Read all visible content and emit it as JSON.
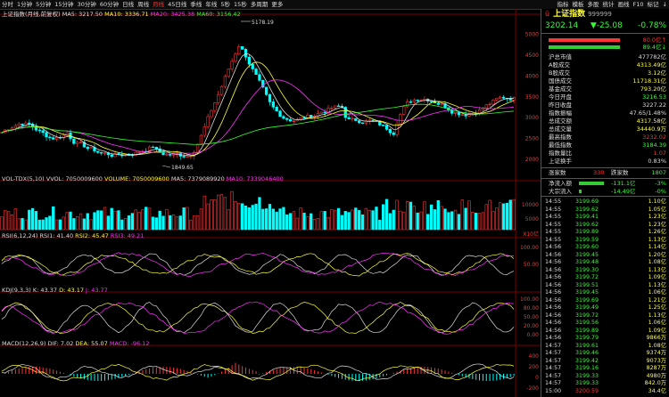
{
  "toolbar": {
    "periods": [
      "分时",
      "1分钟",
      "5分钟",
      "15分钟",
      "30分钟",
      "60分钟",
      "日线",
      "周线",
      "月线",
      "45日线",
      "季线",
      "年线",
      "5秒",
      "15秒",
      "多周期",
      "更多"
    ],
    "active_period": "月线",
    "right_items": [
      "指标",
      "模板",
      "多股",
      "统计",
      "画线",
      "F10",
      "标记",
      "↓"
    ]
  },
  "main_head": {
    "title": "上证指数(月线,前复权)",
    "ma5": "MA5: 3217.50",
    "ma10": "MA10: 3336.71",
    "ma20": "MA20: 3425.38",
    "ma60": "MA60: 3156.42"
  },
  "main_axis": {
    "labels": [
      "5000",
      "4500",
      "4000",
      "3500",
      "3000",
      "2500",
      "2000"
    ]
  },
  "main_annotations": {
    "high": "5178.19",
    "low": "1849.65"
  },
  "vol_head": {
    "title": "VOL-TDX(5,10)",
    "vvol": "VVOL: 7050009600",
    "volume": "VOLUME: 7050009600",
    "ma5": "MA5: 7379089920",
    "ma10": "MA10: 7339046400"
  },
  "vol_axis": {
    "labels": [
      "10000",
      "5000"
    ],
    "unit": "X10亿"
  },
  "rsi_head": {
    "title": "RSI(6,12,24)",
    "rsi1": "RSI1: 41.40",
    "rsi2": "RSI2: 45.47",
    "rsi3": "RSI3: 49.21"
  },
  "rsi_axis": {
    "labels": [
      "100.00",
      "50.00"
    ]
  },
  "kdj_head": {
    "title": "KDJ(9,3,3)",
    "k": "K: 43.37",
    "d": "D: 43.17",
    "j": "J: 43.77"
  },
  "kdj_axis": {
    "labels": [
      "100.00",
      "80.00",
      "50.00",
      "20.00",
      "0.00"
    ]
  },
  "macd_head": {
    "title": "MACD(12,26,9)",
    "dif": "DIF: 7.02",
    "dea": "DEA: 55.07",
    "macd": "MACD: -96.12"
  },
  "macd_axis": {
    "labels": [
      "400",
      "200",
      "0",
      "-200"
    ]
  },
  "side": {
    "mark": "ŭ",
    "name": "上证指数",
    "code": "999999",
    "price": "3202.14",
    "change": "▼-25.08",
    "pct": "-0.78%",
    "bar1": "80.0亿↑",
    "bar2": "89.4亿↓",
    "stats": [
      {
        "label": "沪总市值",
        "value": "477782亿",
        "color": "#dddddd"
      },
      {
        "label": "A股成交",
        "value": "4313.49亿",
        "color": "#ffff33"
      },
      {
        "label": "B股成交",
        "value": "3.12亿",
        "color": "#ffff33"
      },
      {
        "label": "国债成交",
        "value": "11718.31亿",
        "color": "#ffff33"
      },
      {
        "label": "基金成交",
        "value": "793.20亿",
        "color": "#ffff33"
      },
      {
        "label": "今日开盘",
        "value": "3216.53",
        "color": "#33ff33"
      },
      {
        "label": "昨日收盘",
        "value": "3227.22",
        "color": "#dddddd"
      },
      {
        "label": "指数振幅",
        "value": "47.65/1.48%",
        "color": "#dddddd"
      },
      {
        "label": "总成交额",
        "value": "4317.58亿",
        "color": "#ffff33"
      },
      {
        "label": "总成交量",
        "value": "34440.9万",
        "color": "#ffff33"
      },
      {
        "label": "最高指数",
        "value": "3232.02",
        "color": "#ff3333"
      },
      {
        "label": "最低指数",
        "value": "3184.39",
        "color": "#33ff33"
      },
      {
        "label": "指数量比",
        "value": "1.07",
        "color": "#ff3333"
      },
      {
        "label": "上证换手",
        "value": "0.83%",
        "color": "#dddddd"
      }
    ],
    "updown": {
      "label": "涨家数",
      "up": "330",
      "down_label": "跌家数",
      "down": "1807"
    },
    "flow": [
      {
        "label": "净流入额",
        "value": "-131.1亿",
        "pct": "-3%"
      },
      {
        "label": "大宗流入",
        "value": "-14.49亿",
        "pct": "-0%"
      }
    ],
    "ticks": [
      {
        "t": "14:55",
        "p": "3199.69",
        "q": "1.10亿",
        "c": "#33ff33"
      },
      {
        "t": "14:55",
        "p": "3199.62",
        "q": "1.05亿",
        "c": "#33ff33"
      },
      {
        "t": "14:55",
        "p": "3199.41",
        "q": "1.23亿",
        "c": "#33ff33"
      },
      {
        "t": "14:55",
        "p": "3199.62",
        "q": "1.23亿",
        "c": "#33ff33"
      },
      {
        "t": "14:55",
        "p": "3199.89",
        "q": "1.26亿",
        "c": "#33ff33"
      },
      {
        "t": "14:55",
        "p": "3199.59",
        "q": "1.13亿",
        "c": "#33ff33"
      },
      {
        "t": "14:56",
        "p": "3199.60",
        "q": "1.14亿",
        "c": "#33ff33"
      },
      {
        "t": "14:56",
        "p": "3199.45",
        "q": "1.20亿",
        "c": "#33ff33"
      },
      {
        "t": "14:56",
        "p": "3199.48",
        "q": "1.08亿",
        "c": "#33ff33"
      },
      {
        "t": "14:56",
        "p": "3199.30",
        "q": "1.13亿",
        "c": "#33ff33"
      },
      {
        "t": "14:56",
        "p": "3199.72",
        "q": "1.09亿",
        "c": "#33ff33"
      },
      {
        "t": "14:56",
        "p": "3199.51",
        "q": "1.13亿",
        "c": "#33ff33"
      },
      {
        "t": "14:56",
        "p": "3199.45",
        "q": "1.06亿",
        "c": "#33ff33"
      },
      {
        "t": "14:56",
        "p": "3199.69",
        "q": "1.21亿",
        "c": "#33ff33"
      },
      {
        "t": "14:56",
        "p": "3199.49",
        "q": "1.25亿",
        "c": "#33ff33"
      },
      {
        "t": "14:56",
        "p": "3199.72",
        "q": "1.13亿",
        "c": "#33ff33"
      },
      {
        "t": "14:56",
        "p": "3199.56",
        "q": "1.06亿",
        "c": "#33ff33"
      },
      {
        "t": "14:56",
        "p": "3199.89",
        "q": "1.09亿",
        "c": "#33ff33"
      },
      {
        "t": "14:56",
        "p": "3199.79",
        "q": "9866万",
        "c": "#33ff33"
      },
      {
        "t": "14:57",
        "p": "3199.61",
        "q": "1.08亿",
        "c": "#33ff33"
      },
      {
        "t": "14:57",
        "p": "3199.46",
        "q": "9374万",
        "c": "#33ff33"
      },
      {
        "t": "14:57",
        "p": "3199.42",
        "q": "9073万",
        "c": "#33ff33"
      },
      {
        "t": "14:57",
        "p": "3199.16",
        "q": "8287万",
        "c": "#33ff33"
      },
      {
        "t": "14:57",
        "p": "3199.33",
        "q": "4980万",
        "c": "#33ff33"
      },
      {
        "t": "14:57",
        "p": "3199.33",
        "q": "842.0万",
        "c": "#33ff33"
      },
      {
        "t": "15:00",
        "p": "3200.59",
        "q": "34.4亿",
        "c": "#ff3333"
      }
    ]
  }
}
